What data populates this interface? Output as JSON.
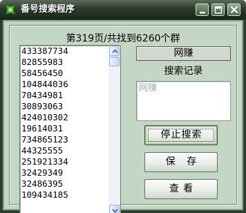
{
  "window": {
    "title": "番号搜索程序"
  },
  "status": {
    "text": "第319页/共找到6260个群"
  },
  "results": {
    "items": [
      "433387734",
      "82855983",
      "58456450",
      "104844036",
      "70434981",
      "30893063",
      "424010302",
      "19614031",
      "734865123",
      "44325555",
      "251921334",
      "32429349",
      "32486395",
      "109434185"
    ]
  },
  "keyword": {
    "value": "网赚"
  },
  "records": {
    "label": "搜索记录",
    "content": "网赚"
  },
  "buttons": {
    "stop_label": "停止搜索",
    "save_label": "保 存",
    "view_label": "查看"
  },
  "colors": {
    "titlebar": "#2e3c2e",
    "body": "#c4d6c4",
    "icon_green": "#4caf2f"
  }
}
